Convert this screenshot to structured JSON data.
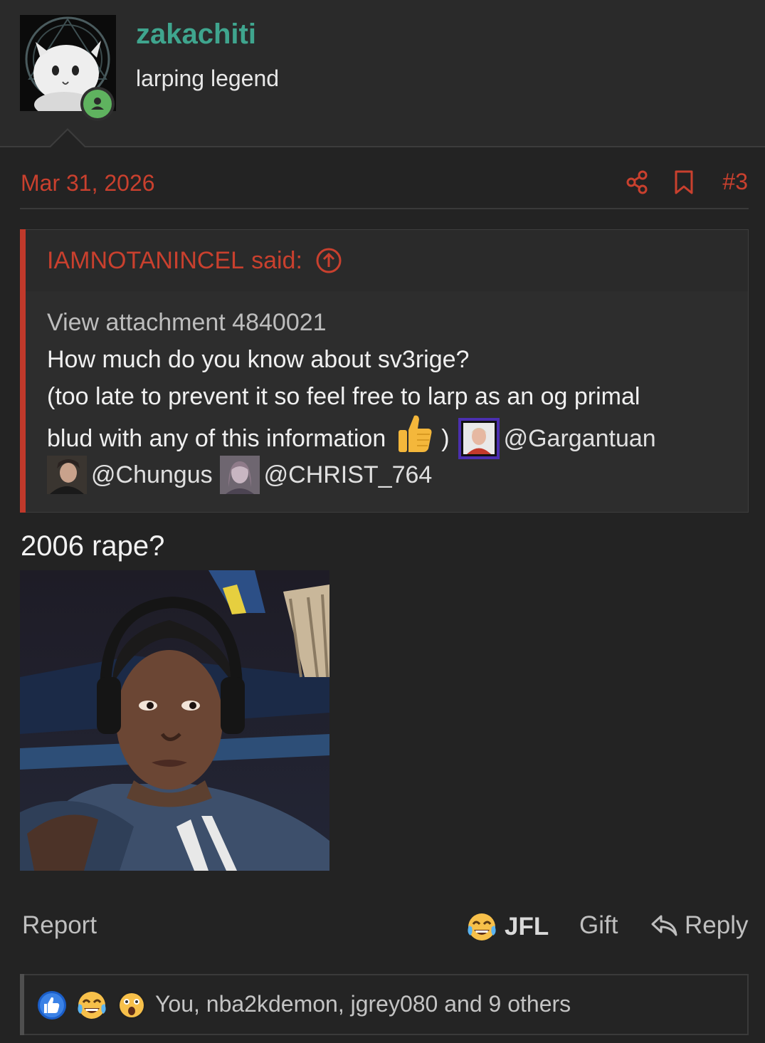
{
  "user": {
    "username": "zakachiti",
    "title": "larping legend",
    "status": "online"
  },
  "post": {
    "date": "Mar 31, 2026",
    "number": "#3",
    "text": "2006 rape?"
  },
  "quote": {
    "author": "IAMNOTANINCEL",
    "said": "said:",
    "attachment": "View attachment 4840021",
    "line1": "How much do you know about sv3rige?",
    "line2": "(too late to prevent it so feel free to larp as an og primal",
    "line3": "blud with any of this information",
    "paren": ")",
    "mentions": [
      "@Gargantuan",
      "@Chungus",
      "@CHRIST_764"
    ]
  },
  "actions": {
    "report": "Report",
    "jfl": "JFL",
    "gift": "Gift",
    "reply": "Reply"
  },
  "reactions": {
    "text": "You, nba2kdemon, jgrey080 and 9 others"
  },
  "colors": {
    "accent_red": "#c9402e",
    "username_teal": "#3fa58e",
    "online_green": "#5fb35f",
    "background": "#232323"
  }
}
